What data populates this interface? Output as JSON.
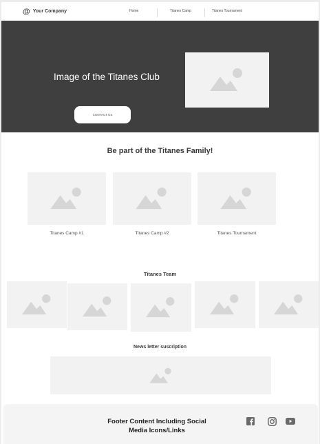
{
  "header": {
    "brand_icon": "@",
    "company": "Your Company",
    "nav": [
      "Home",
      "Titanes Camp",
      "Titanes Tournament"
    ]
  },
  "hero": {
    "title": "Image  of the Titanes Club",
    "button": "CONTACT US",
    "background_color": "#3f3f3f",
    "image_icon": "image-placeholder-icon"
  },
  "family": {
    "title": "Be part of the Titanes Family!",
    "cards": [
      {
        "label": "Titanes Camp #1"
      },
      {
        "label": "Titanes Camp #2"
      },
      {
        "label": "Titanes Tournament"
      }
    ]
  },
  "team": {
    "title": "Titanes Team",
    "member_count": 5
  },
  "newsletter": {
    "title": "News letter suscription"
  },
  "footer": {
    "text": "Footer Content Including Social Media Icons/Links",
    "social_icons": [
      "facebook-icon",
      "instagram-icon",
      "youtube-icon"
    ]
  },
  "colors": {
    "placeholder": "#f2f2f2",
    "placeholder_icon": "#d6d6d6",
    "text": "#3a3a3a"
  }
}
